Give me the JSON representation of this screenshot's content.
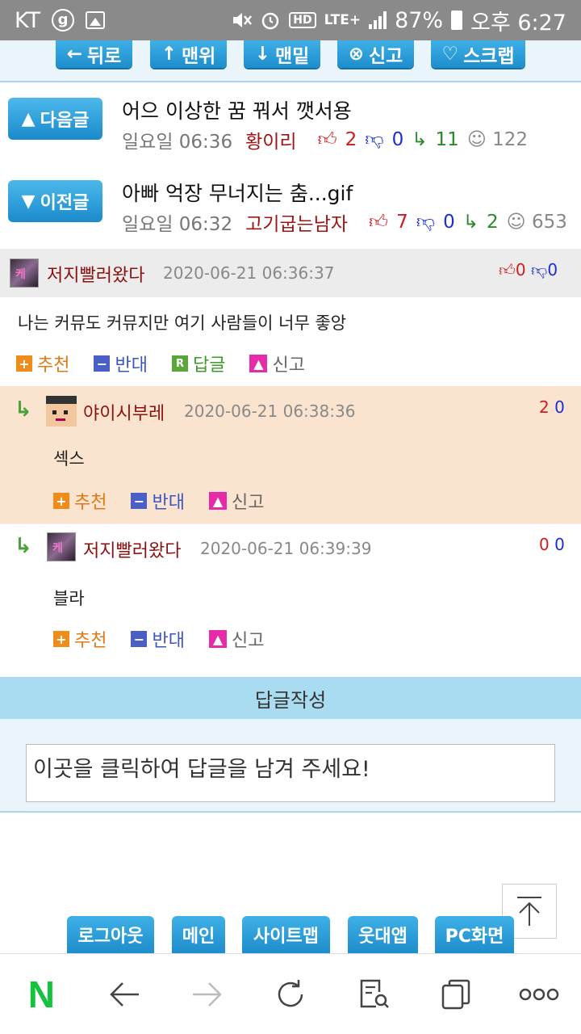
{
  "status_bar": {
    "carrier": "KT",
    "lte": "LTE+",
    "battery": "87%",
    "time": "오후 6:27"
  },
  "top_nav": {
    "back": "뒤로",
    "top": "맨위",
    "bottom": "맨밑",
    "report": "신고",
    "scrap": "스크랩"
  },
  "next_post": {
    "button": "다음글",
    "title": "어으 이상한 꿈 꿔서 깻서용",
    "time": "일요일 06:36",
    "author": "황이리",
    "up": "2",
    "down": "0",
    "replies": "11",
    "views": "122"
  },
  "prev_post": {
    "button": "이전글",
    "title": "아빠 억장 무너지는 춤...gif",
    "time": "일요일 06:32",
    "author": "고기굽는남자",
    "up": "7",
    "down": "0",
    "replies": "2",
    "views": "653"
  },
  "comment": {
    "author": "저지빨러왔다",
    "date": "2020-06-21 06:36:37",
    "up": "0",
    "down": "0",
    "text": "나는 커뮤도 커뮤지만 여기 사람들이 너무 좋앙",
    "recommend": "추천",
    "oppose": "반대",
    "reply": "답글",
    "report": "신고"
  },
  "reply1": {
    "author": "야이시부레",
    "date": "2020-06-21 06:38:36",
    "up": "2",
    "down": "0",
    "text": "섹스",
    "recommend": "추천",
    "oppose": "반대",
    "report": "신고"
  },
  "reply2": {
    "author": "저지빨러왔다",
    "date": "2020-06-21 06:39:39",
    "up": "0",
    "down": "0",
    "text": "블라",
    "recommend": "추천",
    "oppose": "반대",
    "report": "신고"
  },
  "write": {
    "header": "답글작성",
    "placeholder": "이곳을 클릭하여 답글을 남겨 주세요!"
  },
  "footer": {
    "logout": "로그아웃",
    "main": "메인",
    "sitemap": "사이트맵",
    "app": "웃대앱",
    "pc": "PC화면"
  },
  "browser_bar": {
    "naver": "N"
  }
}
